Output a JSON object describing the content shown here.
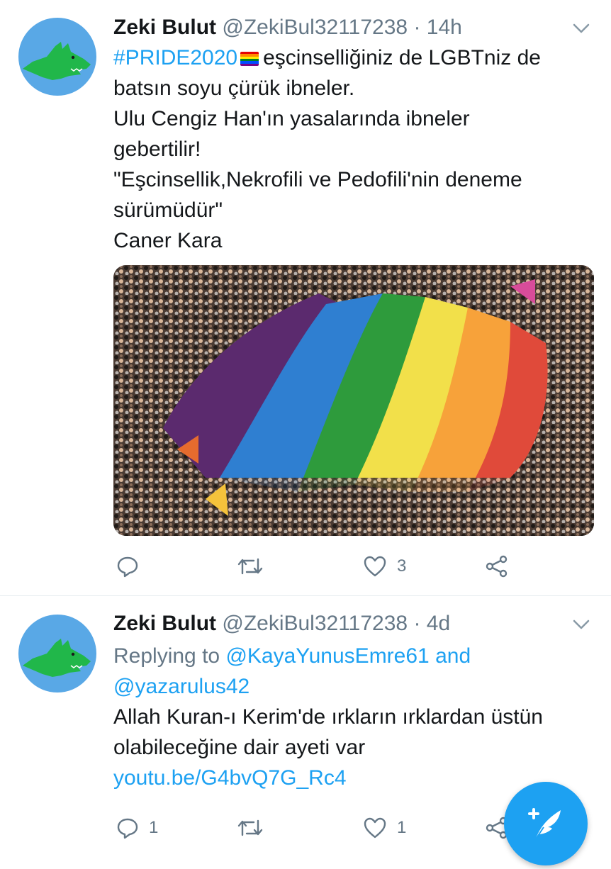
{
  "tweets": [
    {
      "author_name": "Zeki Bulut",
      "handle": "@ZekiBul32117238",
      "separator": "·",
      "time": "14h",
      "hashtag": "#PRIDE2020",
      "lines": [
        "eşcinselliğiniz de LGBTniz de",
        "batsın soyu çürük ibneler.",
        "Ulu Cengiz Han'ın yasalarında ibneler",
        "gebertilir!",
        "\"Eşcinsellik,Nekrofili ve Pedofili'nin deneme",
        "sürümüdür\"",
        "Caner Kara"
      ],
      "actions": {
        "replies": "",
        "retweets": "",
        "likes": "3"
      }
    },
    {
      "author_name": "Zeki Bulut",
      "handle": "@ZekiBul32117238",
      "separator": "·",
      "time": "4d",
      "replying_prefix": "Replying to",
      "replying_user1": "@KayaYunusEmre61",
      "replying_and": "and",
      "replying_user2": "@yazarulus42",
      "lines": [
        "Allah Kuran-ı Kerim'de ırkların ırklardan üstün",
        "olabileceğine dair ayeti var"
      ],
      "link": "youtu.be/G4bvQ7G_Rc4",
      "actions": {
        "replies": "1",
        "retweets": "",
        "likes": "1"
      }
    }
  ],
  "icons": {
    "reply": "reply-icon",
    "retweet": "retweet-icon",
    "like": "heart-icon",
    "share": "share-icon",
    "chevron": "chevron-down-icon",
    "compose": "compose-tweet-icon"
  },
  "colors": {
    "link": "#1da1f2",
    "muted": "#657786",
    "text": "#14171a",
    "avatar_bg": "#59a8e6",
    "avatar_wolf": "#21b74a",
    "fab": "#1da1f2"
  }
}
